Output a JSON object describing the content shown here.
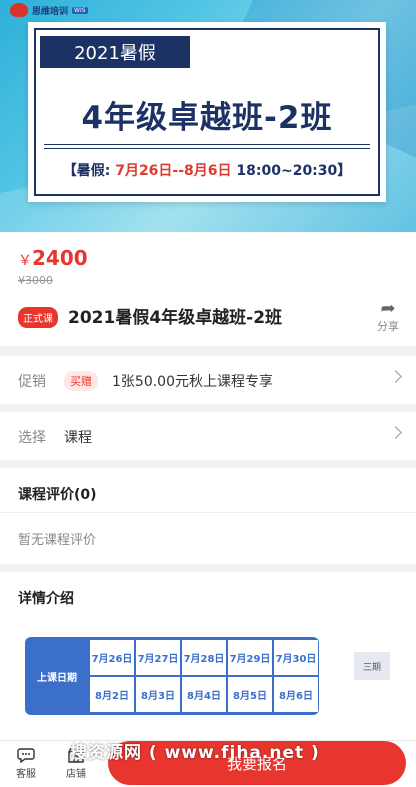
{
  "banner": {
    "logo_text": "思维培训",
    "logo_tag": "WIS",
    "tag": "2021暑假",
    "title": "4年级卓越班-2班",
    "time_prefix": "【暑假: ",
    "time_dates": "7月26日--8月6日",
    "time_hours": "  18:00~20:30】"
  },
  "product": {
    "currency": "￥",
    "price": "2400",
    "original_price": "¥3000",
    "badge": "正式课",
    "title": "2021暑假4年级卓越班-2班",
    "share_label": "分享"
  },
  "promo": {
    "label": "促销",
    "badge": "买赠",
    "text": "1张50.00元秋上课程专享"
  },
  "select": {
    "label": "选择",
    "value": "课程"
  },
  "review": {
    "title": "课程评价(0)",
    "empty": "暂无课程评价"
  },
  "detail": {
    "title": "详情介绍",
    "schedule_header": "上课日期",
    "dates_row1": [
      "7月26日",
      "7月27日",
      "7月28日",
      "7月29日",
      "7月30日"
    ],
    "dates_row2": [
      "8月2日",
      "8月3日",
      "8月4日",
      "8月5日",
      "8月6日"
    ],
    "period_chip": "三期"
  },
  "bottom": {
    "service_label": "客服",
    "store_label": "店铺",
    "cta_label": "我要报名"
  },
  "watermark": "搜资源网 ( www.fjha.net )",
  "colors": {
    "accent": "#e8362e",
    "navy": "#1d3264",
    "schedule_blue": "#3b6fc9"
  }
}
